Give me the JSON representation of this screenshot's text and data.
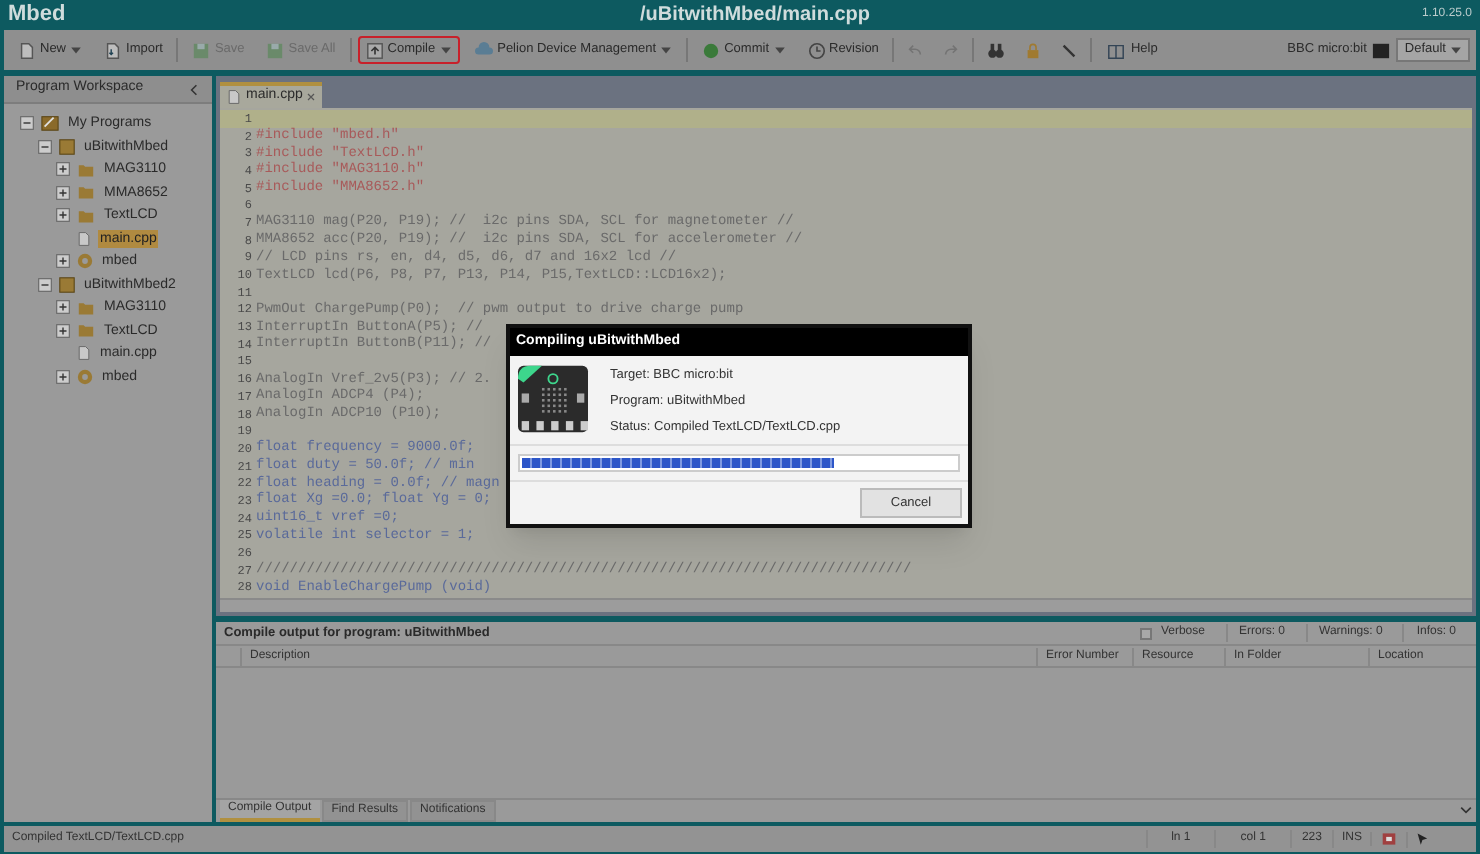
{
  "window": {
    "title": "Mbed",
    "path": "/uBitwithMbed/main.cpp",
    "version": "1.10.25.0"
  },
  "toolbar": {
    "items": [
      {
        "kind": "button",
        "label": "New",
        "dropdown": true,
        "disabled": false,
        "highlighted": false
      },
      {
        "kind": "button",
        "label": "Import",
        "dropdown": false,
        "disabled": false,
        "highlighted": false
      },
      {
        "kind": "separator"
      },
      {
        "kind": "button",
        "label": "Save",
        "dropdown": false,
        "disabled": true,
        "highlighted": false
      },
      {
        "kind": "button",
        "label": "Save All",
        "dropdown": false,
        "disabled": true,
        "highlighted": false
      },
      {
        "kind": "separator"
      },
      {
        "kind": "button",
        "label": "Compile",
        "dropdown": true,
        "disabled": false,
        "highlighted": true
      },
      {
        "kind": "button",
        "label": "Pelion Device Management",
        "dropdown": true,
        "disabled": false,
        "highlighted": false
      },
      {
        "kind": "separator"
      },
      {
        "kind": "button",
        "label": "Commit",
        "dropdown": true,
        "disabled": false,
        "highlighted": false
      },
      {
        "kind": "button",
        "label": "Revision",
        "dropdown": false,
        "disabled": false,
        "highlighted": false
      },
      {
        "kind": "separator"
      },
      {
        "kind": "icon",
        "disabled": true
      },
      {
        "kind": "icon",
        "disabled": true
      },
      {
        "kind": "separator"
      },
      {
        "kind": "icon",
        "disabled": false
      },
      {
        "kind": "icon",
        "disabled": false
      },
      {
        "kind": "icon",
        "disabled": false
      },
      {
        "kind": "separator"
      },
      {
        "kind": "button",
        "label": "Help",
        "dropdown": false,
        "disabled": false,
        "highlighted": false
      }
    ],
    "target": "BBC micro:bit",
    "workspace_select": "Default"
  },
  "sidebar": {
    "title": "Program Workspace",
    "tree": [
      {
        "label": "My Programs",
        "kind": "workspace",
        "expanded": true,
        "selected": false,
        "children": [
          {
            "label": "uBitwithMbed",
            "kind": "program",
            "expanded": true,
            "selected": false,
            "children": [
              {
                "label": "MAG3110",
                "kind": "folder",
                "expanded": false,
                "selected": false
              },
              {
                "label": "MMA8652",
                "kind": "folder",
                "expanded": false,
                "selected": false
              },
              {
                "label": "TextLCD",
                "kind": "folder",
                "expanded": false,
                "selected": false
              },
              {
                "label": "main.cpp",
                "kind": "file",
                "selected": true
              },
              {
                "label": "mbed",
                "kind": "library",
                "expanded": false,
                "selected": false
              }
            ]
          },
          {
            "label": "uBitwithMbed2",
            "kind": "program",
            "expanded": true,
            "selected": false,
            "children": [
              {
                "label": "MAG3110",
                "kind": "folder",
                "expanded": false,
                "selected": false
              },
              {
                "label": "TextLCD",
                "kind": "folder",
                "expanded": false,
                "selected": false
              },
              {
                "label": "main.cpp",
                "kind": "file",
                "selected": false
              },
              {
                "label": "mbed",
                "kind": "library",
                "expanded": false,
                "selected": false
              }
            ]
          }
        ]
      }
    ]
  },
  "editor": {
    "tabs": [
      {
        "label": "main.cpp",
        "selected": true
      }
    ],
    "lines": [
      {
        "number": "1",
        "kind": "blank",
        "current": true
      },
      {
        "number": "2",
        "kind": "directive",
        "text": "#include \"mbed.h\"",
        "current": false
      },
      {
        "number": "3",
        "kind": "directive",
        "text": "#include \"TextLCD.h\"",
        "current": false
      },
      {
        "number": "4",
        "kind": "directive",
        "text": "#include \"MAG3110.h\"",
        "current": false
      },
      {
        "number": "5",
        "kind": "directive",
        "text": "#include \"MMA8652.h\"",
        "current": false
      },
      {
        "number": "6",
        "kind": "blank",
        "current": false
      },
      {
        "number": "7",
        "kind": "code",
        "text": "MAG3110 mag(P20, P19); //  i2c pins SDA, SCL for magnetometer //",
        "current": false
      },
      {
        "number": "8",
        "kind": "code",
        "text": "MMA8652 acc(P20, P19); //  i2c pins SDA, SCL for accelerometer //",
        "current": false
      },
      {
        "number": "9",
        "kind": "code",
        "text": "// LCD pins rs, en, d4, d5, d6, d7 and 16x2 lcd //",
        "current": false
      },
      {
        "number": "10",
        "kind": "code",
        "text": "TextLCD lcd(P6, P8, P7, P13, P14, P15,TextLCD::LCD16x2);",
        "current": false
      },
      {
        "number": "11",
        "kind": "blank",
        "current": false
      },
      {
        "number": "12",
        "kind": "code",
        "text": "PwmOut ChargePump(P0);  // pwm output to drive charge pump",
        "current": false
      },
      {
        "number": "13",
        "kind": "code",
        "text": "InterruptIn ButtonA(P5); //",
        "current": false
      },
      {
        "number": "14",
        "kind": "code",
        "text": "InterruptIn ButtonB(P11); //",
        "current": false
      },
      {
        "number": "15",
        "kind": "blank",
        "current": false
      },
      {
        "number": "16",
        "kind": "code",
        "text": "AnalogIn Vref_2v5(P3); // 2.",
        "current": false
      },
      {
        "number": "17",
        "kind": "code",
        "text": "AnalogIn ADCP4 (P4);",
        "current": false
      },
      {
        "number": "18",
        "kind": "code",
        "text": "AnalogIn ADCP10 (P10);",
        "current": false
      },
      {
        "number": "19",
        "kind": "blank",
        "current": false
      },
      {
        "number": "20",
        "kind": "declaration",
        "text": "float frequency = 9000.0f;",
        "current": false
      },
      {
        "number": "21",
        "kind": "declaration",
        "text": "float duty = 50.0f; // min",
        "current": false
      },
      {
        "number": "22",
        "kind": "declaration",
        "text": "float heading = 0.0f; // magn",
        "current": false
      },
      {
        "number": "23",
        "kind": "declaration",
        "text": "float Xg =0.0; float Yg = 0;",
        "current": false
      },
      {
        "number": "24",
        "kind": "declaration",
        "text": "uint16_t vref =0;",
        "current": false
      },
      {
        "number": "25",
        "kind": "declaration",
        "text": "volatile int selector = 1;",
        "current": false
      },
      {
        "number": "26",
        "kind": "blank",
        "current": false
      },
      {
        "number": "27",
        "kind": "code",
        "text": "//////////////////////////////////////////////////////////////////////////////",
        "current": false
      },
      {
        "number": "28",
        "kind": "declaration",
        "text": "void EnableChargePump (void)",
        "current": false
      }
    ]
  },
  "compile_output": {
    "title": "Compile output for program: uBitwithMbed",
    "verbose": {
      "label": "Verbose",
      "checked": false
    },
    "counters": [
      "Errors: 0",
      "Warnings: 0",
      "Infos: 0"
    ],
    "columns": [
      "Description",
      "Error Number",
      "Resource",
      "In Folder",
      "Location"
    ],
    "tabs": [
      {
        "label": "Compile Output",
        "selected": true
      },
      {
        "label": "Find Results",
        "selected": false
      },
      {
        "label": "Notifications",
        "selected": false
      }
    ]
  },
  "status_bar": {
    "message": "Compiled TextLCD/TextLCD.cpp",
    "line": "ln 1",
    "column": "col 1",
    "count": "223",
    "mode": "INS"
  },
  "dialog": {
    "title": "Compiling uBitwithMbed",
    "target": "Target: BBC micro:bit",
    "program": "Program: uBitwithMbed",
    "status": "Status: Compiled TextLCD/TextLCD.cpp",
    "progress": {
      "level": 0.72
    },
    "button": "Cancel"
  }
}
